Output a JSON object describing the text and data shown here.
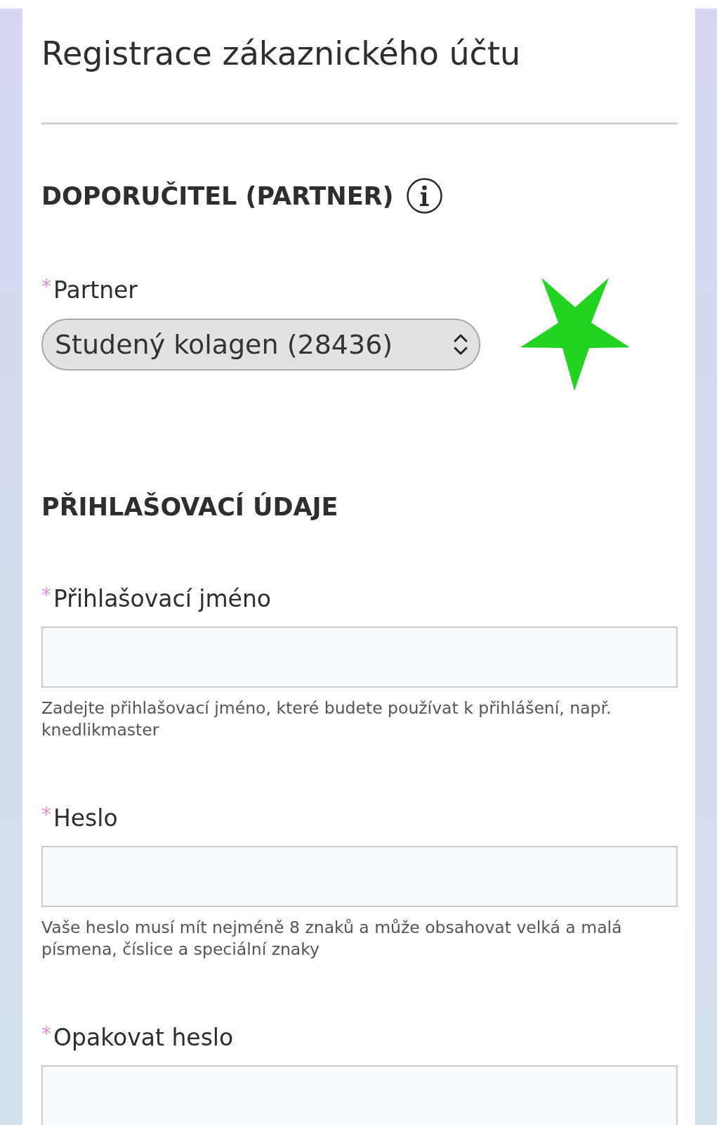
{
  "title": "Registrace zákaznického účtu",
  "sections": [
    {
      "heading": "DOPORUČITEL (PARTNER)",
      "info": true,
      "fields": [
        {
          "kind": "select",
          "required_mark": "*",
          "label": "Partner",
          "value": "Studený kolagen (28436)",
          "star_marker": true
        }
      ]
    },
    {
      "heading": "PŘIHLAŠOVACÍ ÚDAJE",
      "info": false,
      "fields": [
        {
          "kind": "input",
          "required_mark": "*",
          "label": "Přihlašovací jméno",
          "help": "Zadejte přihlašovací jméno, které budete používat k přihlášení, např. knedlikmaster"
        },
        {
          "kind": "input",
          "required_mark": "*",
          "label": "Heslo",
          "help": "Vaše heslo musí mít nejméně 8 znaků a může obsahovat velká a malá písmena, číslice a speciální znaky"
        },
        {
          "kind": "input",
          "required_mark": "*",
          "label": "Opakovat heslo"
        }
      ]
    }
  ]
}
